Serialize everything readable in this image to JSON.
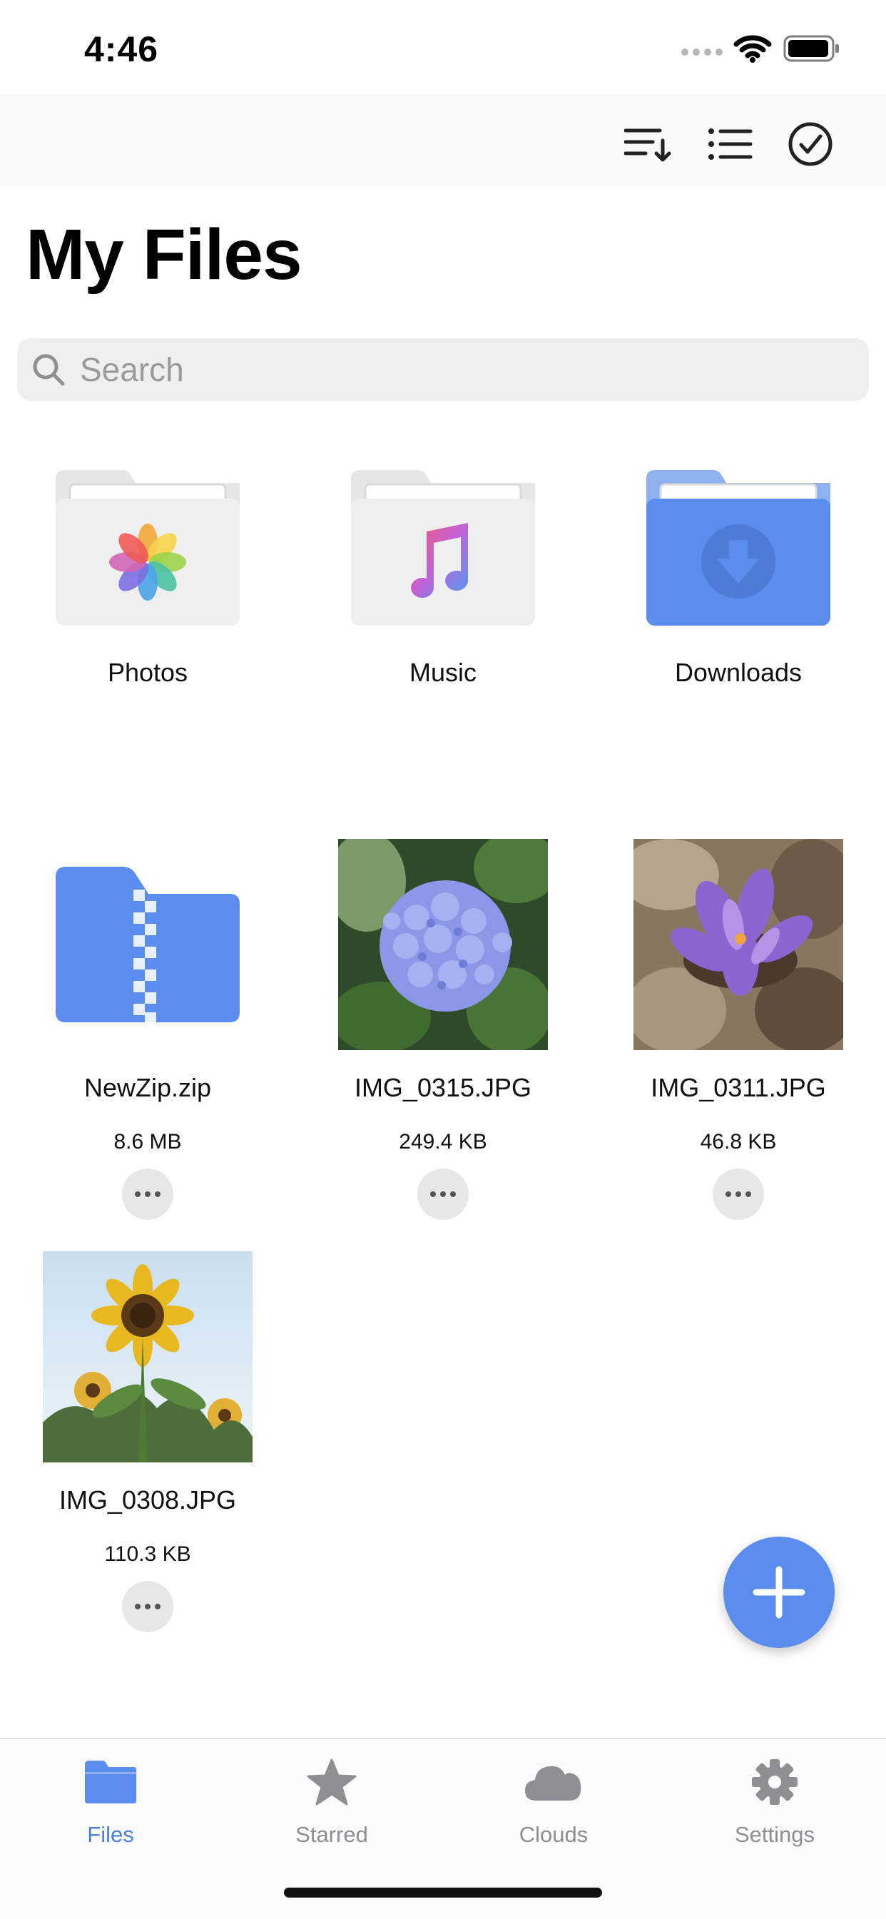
{
  "status_bar": {
    "time": "4:46"
  },
  "toolbar": {
    "sort_icon": "sort-descending-icon",
    "list_icon": "list-view-icon",
    "select_icon": "checkmark-circle-icon"
  },
  "page": {
    "title": "My Files"
  },
  "search": {
    "placeholder": "Search",
    "value": ""
  },
  "folders": [
    {
      "name": "Photos",
      "icon": "photos-folder-icon"
    },
    {
      "name": "Music",
      "icon": "music-folder-icon"
    },
    {
      "name": "Downloads",
      "icon": "downloads-folder-icon"
    }
  ],
  "files": [
    {
      "name": "NewZip.zip",
      "size": "8.6 MB",
      "icon": "zip-file-icon"
    },
    {
      "name": "IMG_0315.JPG",
      "size": "249.4 KB",
      "icon": "hydrangea-photo"
    },
    {
      "name": "IMG_0311.JPG",
      "size": "46.8 KB",
      "icon": "crocus-photo"
    },
    {
      "name": "IMG_0308.JPG",
      "size": "110.3 KB",
      "icon": "sunflower-photo"
    }
  ],
  "fab": {
    "icon": "plus-icon"
  },
  "tabs": [
    {
      "label": "Files",
      "icon": "folder-icon",
      "active": true
    },
    {
      "label": "Starred",
      "icon": "star-icon",
      "active": false
    },
    {
      "label": "Clouds",
      "icon": "cloud-icon",
      "active": false
    },
    {
      "label": "Settings",
      "icon": "gear-icon",
      "active": false
    }
  ],
  "colors": {
    "accent": "#5b8def",
    "tab_active": "#4b7fd9",
    "tab_inactive": "#8e8e93",
    "search_bg": "#efefef"
  }
}
